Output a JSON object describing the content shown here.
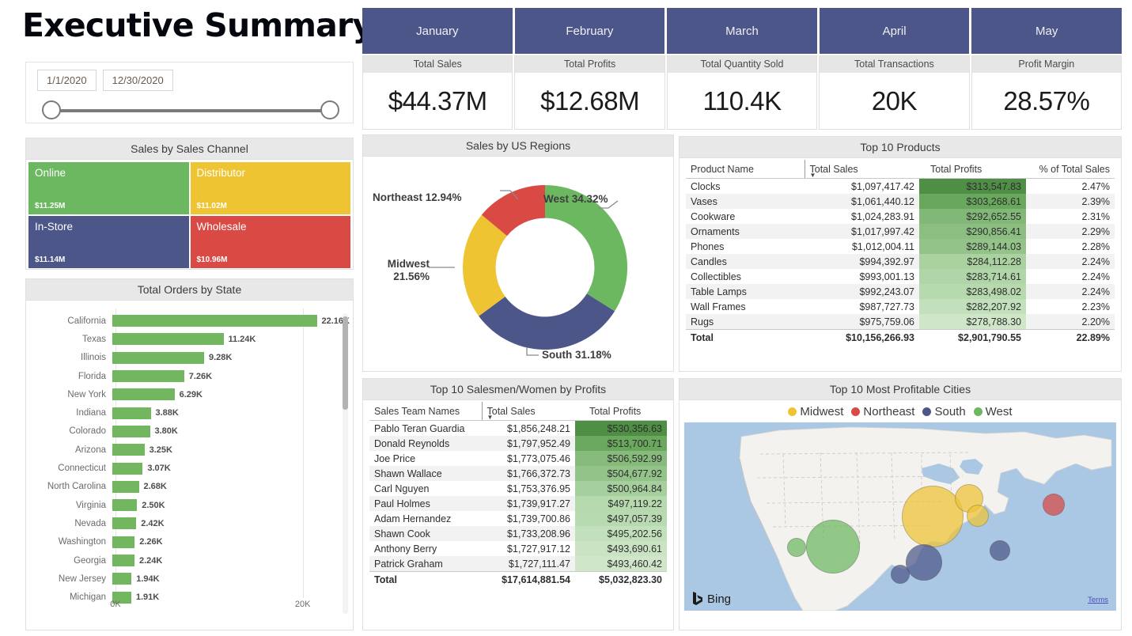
{
  "page_title": "Executive Summary",
  "slicer": {
    "start_date": "1/1/2020",
    "end_date": "12/30/2020"
  },
  "month_tabs": [
    "January",
    "February",
    "March",
    "April",
    "May"
  ],
  "kpis": [
    {
      "label": "Total Sales",
      "value": "$44.37M"
    },
    {
      "label": "Total Profits",
      "value": "$12.68M"
    },
    {
      "label": "Total Quantity Sold",
      "value": "110.4K"
    },
    {
      "label": "Total Transactions",
      "value": "20K"
    },
    {
      "label": "Profit Margin",
      "value": "28.57%"
    }
  ],
  "treemap": {
    "title": "Sales by Sales Channel",
    "cells": [
      {
        "name": "Online",
        "value": "$11.25M",
        "color": "#6cb860"
      },
      {
        "name": "Distributor",
        "value": "$11.02M",
        "color": "#efc433"
      },
      {
        "name": "In-Store",
        "value": "$11.14M",
        "color": "#4c5688"
      },
      {
        "name": "Wholesale",
        "value": "$10.96M",
        "color": "#d94a45"
      }
    ]
  },
  "chart_data": [
    {
      "type": "bar",
      "title": "Total Orders by State",
      "orientation": "horizontal",
      "xlabel": "",
      "ylabel": "",
      "xlim": [
        0,
        24000
      ],
      "ticks": [
        "0K",
        "20K"
      ],
      "tick_values": [
        0,
        20000
      ],
      "grid": true,
      "bar_color": "#72b65f",
      "categories": [
        "California",
        "Texas",
        "Illinois",
        "Florida",
        "New York",
        "Indiana",
        "Colorado",
        "Arizona",
        "Connecticut",
        "North Carolina",
        "Virginia",
        "Nevada",
        "Washington",
        "Georgia",
        "New Jersey",
        "Michigan"
      ],
      "values": [
        22160,
        11240,
        9280,
        7260,
        6290,
        3880,
        3800,
        3250,
        3070,
        2680,
        2500,
        2420,
        2260,
        2240,
        1940,
        1910
      ],
      "labels": [
        "22.16K",
        "11.24K",
        "9.28K",
        "7.26K",
        "6.29K",
        "3.88K",
        "3.80K",
        "3.25K",
        "3.07K",
        "2.68K",
        "2.50K",
        "2.42K",
        "2.26K",
        "2.24K",
        "1.94K",
        "1.91K"
      ]
    },
    {
      "type": "pie",
      "subtype": "donut",
      "title": "Sales by US Regions",
      "categories": [
        "West",
        "South",
        "Midwest",
        "Northeast"
      ],
      "values": [
        34.32,
        31.18,
        21.56,
        12.94
      ],
      "labels": [
        "West 34.32%",
        "South 31.18%",
        "Midwest 21.56%",
        "Northeast 12.94%"
      ],
      "colors": [
        "#6cb860",
        "#4c5688",
        "#efc433",
        "#d94a45"
      ],
      "legend": "none"
    }
  ],
  "products_table": {
    "title": "Top 10 Products",
    "columns": [
      "Product Name",
      "Total Sales",
      "Total Profits",
      "% of Total Sales"
    ],
    "sorted_by": "Total Sales",
    "sort_direction": "desc",
    "rows": [
      {
        "name": "Clocks",
        "sales": "$1,097,417.42",
        "profits": "$313,547.83",
        "pct": "2.47%",
        "heat": "#4f8f45"
      },
      {
        "name": "Vases",
        "sales": "$1,061,440.12",
        "profits": "$303,268.61",
        "pct": "2.39%",
        "heat": "#68a75c"
      },
      {
        "name": "Cookware",
        "sales": "$1,024,283.91",
        "profits": "$292,652.55",
        "pct": "2.31%",
        "heat": "#82b877"
      },
      {
        "name": "Ornaments",
        "sales": "$1,017,997.42",
        "profits": "$290,856.41",
        "pct": "2.29%",
        "heat": "#8cbe81"
      },
      {
        "name": "Phones",
        "sales": "$1,012,004.11",
        "profits": "$289,144.03",
        "pct": "2.28%",
        "heat": "#93c389"
      },
      {
        "name": "Candles",
        "sales": "$994,392.97",
        "profits": "$284,112.28",
        "pct": "2.24%",
        "heat": "#aad2a1"
      },
      {
        "name": "Collectibles",
        "sales": "$993,001.13",
        "profits": "$283,714.61",
        "pct": "2.24%",
        "heat": "#b0d5a8"
      },
      {
        "name": "Table Lamps",
        "sales": "$992,243.07",
        "profits": "$283,498.02",
        "pct": "2.24%",
        "heat": "#b6d9ae"
      },
      {
        "name": "Wall Frames",
        "sales": "$987,727.73",
        "profits": "$282,207.92",
        "pct": "2.23%",
        "heat": "#c2e0bb"
      },
      {
        "name": "Rugs",
        "sales": "$975,759.06",
        "profits": "$278,788.30",
        "pct": "2.20%",
        "heat": "#cfe6c8"
      }
    ],
    "total": {
      "name": "Total",
      "sales": "$10,156,266.93",
      "profits": "$2,901,790.55",
      "pct": "22.89%"
    }
  },
  "salesteam_table": {
    "title": "Top 10 Salesmen/Women by Profits",
    "columns": [
      "Sales Team Names",
      "Total Sales",
      "Total Profits"
    ],
    "sorted_by": "Total Sales",
    "sort_direction": "desc",
    "rows": [
      {
        "name": "Pablo Teran Guardia",
        "sales": "$1,856,248.21",
        "profits": "$530,356.63",
        "heat": "#4f8f45"
      },
      {
        "name": "Donald Reynolds",
        "sales": "$1,797,952.49",
        "profits": "$513,700.71",
        "heat": "#6aa85e"
      },
      {
        "name": "Joe Price",
        "sales": "$1,773,075.46",
        "profits": "$506,592.99",
        "heat": "#87bb7c"
      },
      {
        "name": "Shawn Wallace",
        "sales": "$1,766,372.73",
        "profits": "$504,677.92",
        "heat": "#93c389"
      },
      {
        "name": "Carl Nguyen",
        "sales": "$1,753,376.95",
        "profits": "$500,964.84",
        "heat": "#a5cf9c"
      },
      {
        "name": "Paul Holmes",
        "sales": "$1,739,917.27",
        "profits": "$497,119.22",
        "heat": "#b6d9ae"
      },
      {
        "name": "Adam Hernandez",
        "sales": "$1,739,700.86",
        "profits": "$497,057.39",
        "heat": "#b8dab0"
      },
      {
        "name": "Shawn Cook",
        "sales": "$1,733,208.96",
        "profits": "$495,202.56",
        "heat": "#c2e0bb"
      },
      {
        "name": "Anthony Berry",
        "sales": "$1,727,917.12",
        "profits": "$493,690.61",
        "heat": "#cae3c3"
      },
      {
        "name": "Patrick Graham",
        "sales": "$1,727,111.47",
        "profits": "$493,460.42",
        "heat": "#cfe6c8"
      }
    ],
    "total": {
      "name": "Total",
      "sales": "$17,614,881.54",
      "profits": "$5,032,823.30"
    }
  },
  "map": {
    "title": "Top 10 Most Profitable Cities",
    "legend": [
      {
        "label": "Midwest",
        "color": "#efc433"
      },
      {
        "label": "Northeast",
        "color": "#d94a45"
      },
      {
        "label": "South",
        "color": "#4c5688"
      },
      {
        "label": "West",
        "color": "#6cb860"
      }
    ],
    "attribution": "Bing",
    "terms_label": "Terms",
    "bubbles": [
      {
        "region": "Midwest",
        "x": 57.5,
        "y": 50.0,
        "r": 39,
        "color": "#efc433"
      },
      {
        "region": "Midwest",
        "x": 66.0,
        "y": 40.5,
        "r": 18,
        "color": "#efc433"
      },
      {
        "region": "Midwest",
        "x": 68.0,
        "y": 49.5,
        "r": 14,
        "color": "#efc433"
      },
      {
        "region": "Northeast",
        "x": 85.5,
        "y": 43.5,
        "r": 14,
        "color": "#d94a45"
      },
      {
        "region": "West",
        "x": 34.5,
        "y": 66.0,
        "r": 34,
        "color": "#6cb860"
      },
      {
        "region": "West",
        "x": 26.0,
        "y": 66.5,
        "r": 12,
        "color": "#6cb860"
      },
      {
        "region": "South",
        "x": 55.5,
        "y": 74.5,
        "r": 23,
        "color": "#4c5688"
      },
      {
        "region": "South",
        "x": 50.0,
        "y": 80.5,
        "r": 12,
        "color": "#4c5688"
      },
      {
        "region": "South",
        "x": 73.0,
        "y": 68.0,
        "r": 13,
        "color": "#4c5688"
      }
    ]
  }
}
